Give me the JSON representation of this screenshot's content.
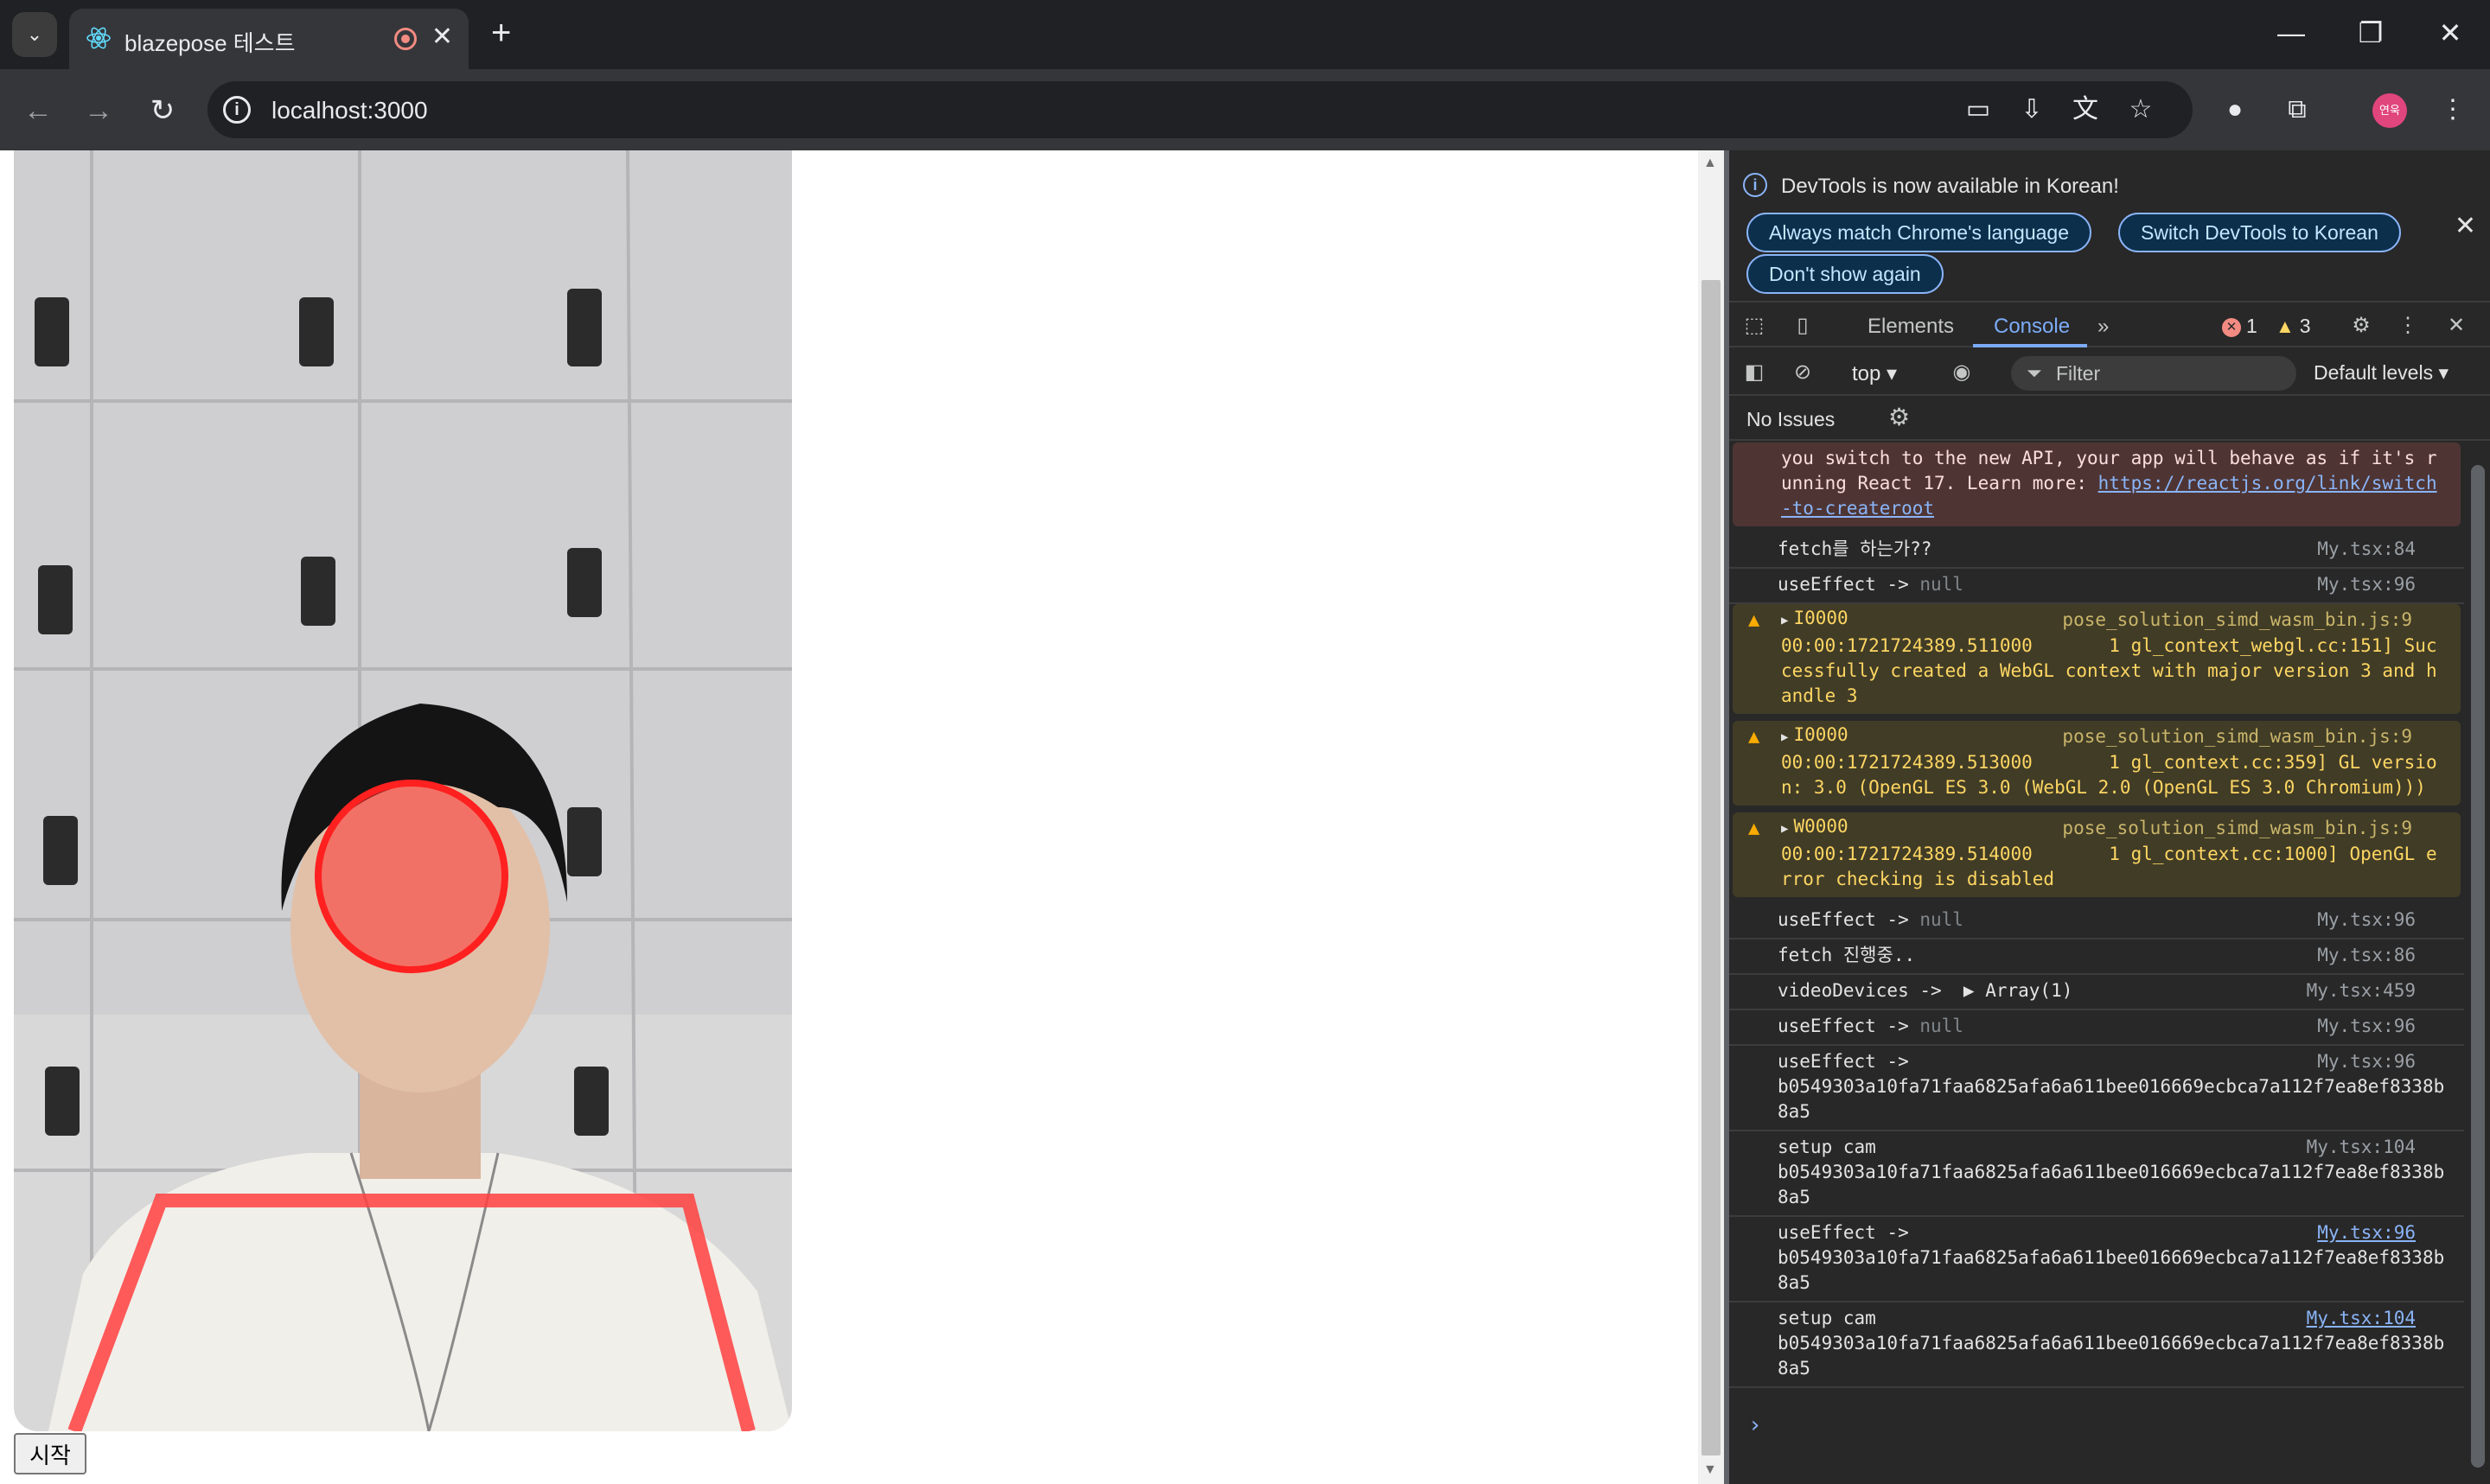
{
  "tab": {
    "title": "blazepose 테스트",
    "close": "✕",
    "new_tab": "+"
  },
  "window": {
    "minimize": "—",
    "restore": "❐",
    "close": "✕"
  },
  "address": {
    "url": "localhost:3000"
  },
  "page": {
    "start_button": "시작"
  },
  "devtools": {
    "banner": {
      "message": "DevTools is now available in Korean!",
      "always_match": "Always match Chrome's language",
      "switch": "Switch DevTools to Korean",
      "dont_show": "Don't show again"
    },
    "tabs": {
      "elements": "Elements",
      "console": "Console",
      "more": "»"
    },
    "counts": {
      "errors": "1",
      "warnings": "3"
    },
    "toolbar": {
      "context": "top",
      "filter_placeholder": "Filter",
      "levels": "Default levels"
    },
    "issues": "No Issues",
    "messages": [
      {
        "level": "error",
        "text": "you switch to the new API, your app will behave as if it's running React 17. Learn more: ",
        "link": "https://reactjs.org/link/switch-to-createroot",
        "src": ""
      },
      {
        "level": "log",
        "text": "fetch를 하는가??",
        "src": "My.tsx:84"
      },
      {
        "level": "log",
        "text": "useEffect -> ",
        "dim": "null",
        "src": "My.tsx:96"
      },
      {
        "level": "warn",
        "head": "I0000",
        "text": "00:00:1721724389.511000       1 gl_context_webgl.cc:151] Successfully created a WebGL context with major version 3 and handle 3",
        "src": "pose_solution_simd_wasm_bin.js:9"
      },
      {
        "level": "warn",
        "head": "I0000",
        "text": "00:00:1721724389.513000       1 gl_context.cc:359] GL version: 3.0 (OpenGL ES 3.0 (WebGL 2.0 (OpenGL ES 3.0 Chromium)))",
        "src": "pose_solution_simd_wasm_bin.js:9"
      },
      {
        "level": "warn",
        "head": "W0000",
        "text": "00:00:1721724389.514000       1 gl_context.cc:1000] OpenGL error checking is disabled",
        "src": "pose_solution_simd_wasm_bin.js:9"
      },
      {
        "level": "log",
        "text": "useEffect -> ",
        "dim": "null",
        "src": "My.tsx:96"
      },
      {
        "level": "log",
        "text": "fetch 진행중..",
        "src": "My.tsx:86"
      },
      {
        "level": "log",
        "text": "videoDevices ->  ▶ Array(1)",
        "src": "My.tsx:459"
      },
      {
        "level": "log",
        "text": "useEffect -> ",
        "dim": "null",
        "src": "My.tsx:96"
      },
      {
        "level": "log",
        "text": "useEffect -> \nb0549303a10fa71faa6825afa6a611bee016669ecbca7a112f7ea8ef8338b8a5",
        "src": "My.tsx:96"
      },
      {
        "level": "log",
        "text": "setup cam \nb0549303a10fa71faa6825afa6a611bee016669ecbca7a112f7ea8ef8338b8a5",
        "src": "My.tsx:104"
      },
      {
        "level": "log",
        "text": "useEffect -> \nb0549303a10fa71faa6825afa6a611bee016669ecbca7a112f7ea8ef8338b8a5",
        "src": "My.tsx:96",
        "link_src": true
      },
      {
        "level": "log",
        "text": "setup cam \nb0549303a10fa71faa6825afa6a611bee016669ecbca7a112f7ea8ef8338b8a5",
        "src": "My.tsx:104",
        "link_src": true
      }
    ],
    "prompt": "›"
  },
  "colors": {
    "overlay": "#ff3030",
    "accent": "#8ab4f8"
  }
}
